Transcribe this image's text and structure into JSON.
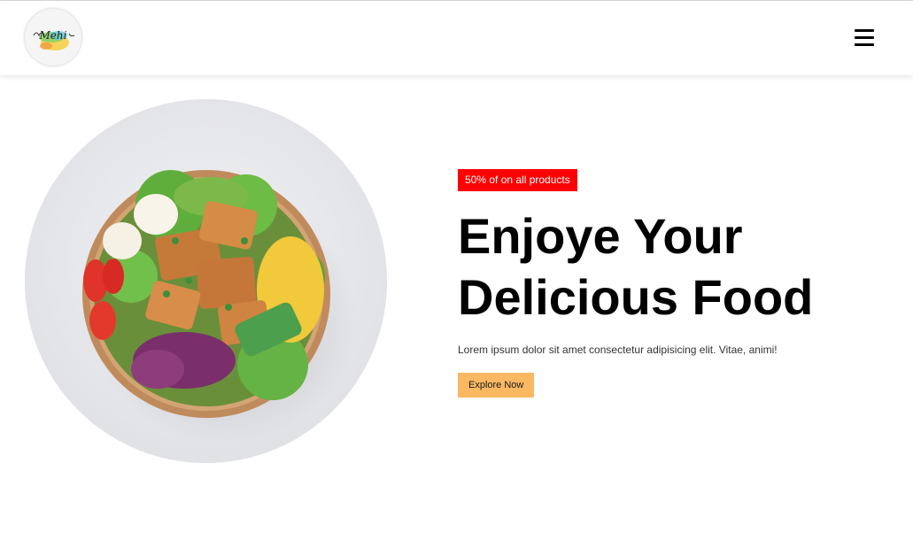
{
  "header": {
    "logo_text": "Mehi",
    "menu_icon": "hamburger-menu-icon"
  },
  "hero": {
    "image_subject": "salad bowl",
    "badge": "50% of on all products",
    "title_line1": "Enjoye Your",
    "title_line2": "Delicious Food",
    "description": "Lorem ipsum dolor sit amet consectetur adipisicing elit. Vitae, animi!",
    "cta_label": "Explore Now"
  },
  "colors": {
    "badge_bg": "#ff0000",
    "cta_bg": "#fbb863",
    "title": "#000000",
    "background": "#ffffff"
  }
}
